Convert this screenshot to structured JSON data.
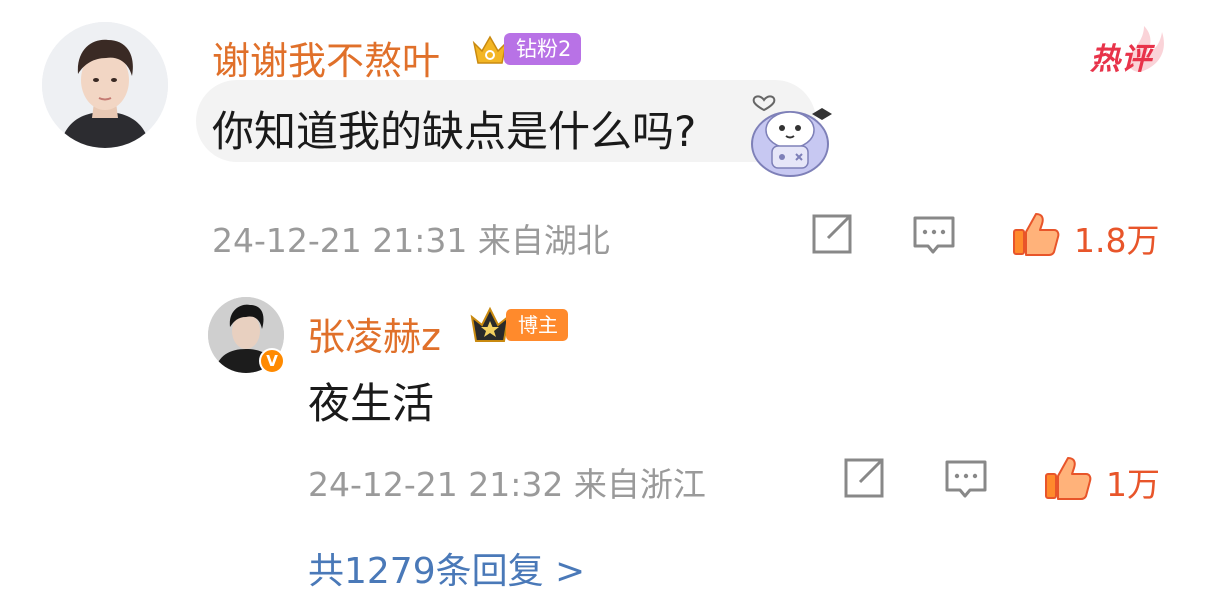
{
  "comment": {
    "username": "谢谢我不熬叶",
    "fan_badge": "钻粉2",
    "hot_tag": "热评",
    "text": "你知道我的缺点是什么吗?",
    "timestamp": "24-12-21 21:31",
    "location": "来自湖北",
    "like_count": "1.8万"
  },
  "reply": {
    "username": "张凌赫z",
    "role_badge": "博主",
    "verified_mark": "V",
    "text": "夜生活",
    "timestamp": "24-12-21 21:32",
    "location": "来自浙江",
    "like_count": "1万"
  },
  "more_replies": "共1279条回复 >",
  "colors": {
    "username": "#e0702a",
    "like": "#e8552a",
    "link": "#4a79b8",
    "meta": "#9a9a9a",
    "hot": "#e8334a",
    "fan_badge": "#b872e6",
    "blogger_badge": "#ff8a2c"
  },
  "icons": {
    "share": "share-icon",
    "comment": "comment-icon",
    "like": "thumbs-up-icon"
  }
}
